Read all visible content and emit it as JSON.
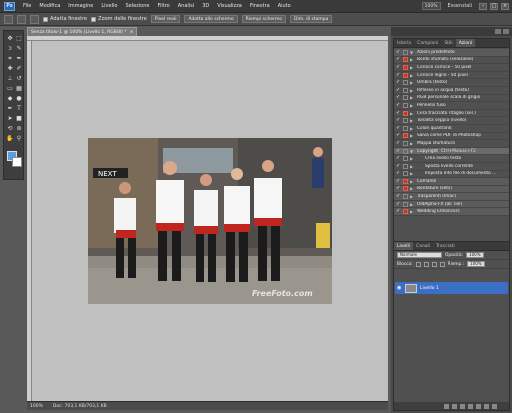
{
  "app": {
    "logo": "Ps"
  },
  "menu": [
    "File",
    "Modifica",
    "Immagine",
    "Livello",
    "Selezione",
    "Filtro",
    "Analisi",
    "3D",
    "Visualizza",
    "Finestra",
    "Aiuto"
  ],
  "menu_right": {
    "zoom": "100%",
    "workspace": "Essenziali"
  },
  "options": {
    "check1": "Adatta finestre",
    "check2": "Zoom delle finestre",
    "btn1": "Pixel reali",
    "btn2": "Adatta allo schermo",
    "btn3": "Riempi schermo",
    "btn4": "Dim. di stampa"
  },
  "doc_tab": {
    "title": "Senza titolo-1 @ 100% (Livello 1, RGB/8) *",
    "close": "×"
  },
  "photo": {
    "sign": "NEXT",
    "watermark": "FreeFoto.com"
  },
  "status": {
    "zoom": "100%",
    "doc": "Doc: 703,1 KB/703,1 KB"
  },
  "actions_panel": {
    "tabs": [
      "Istoria",
      "Campioni",
      "Stili",
      "Azioni"
    ],
    "active_tab": "Azioni",
    "rows": [
      {
        "label": "Azioni predefinite",
        "type": "set",
        "dialog": false,
        "tri": "▼"
      },
      {
        "label": "Bordo sfumato (selezione)",
        "type": "action",
        "dialog": true,
        "tri": "▶"
      },
      {
        "label": "Cornice cornice - 50 pixel",
        "type": "action",
        "dialog": true,
        "tri": "▶"
      },
      {
        "label": "Cornice legno - 50 pixel",
        "type": "action",
        "dialog": true,
        "tri": "▶"
      },
      {
        "label": "Ombra (testo)",
        "type": "action",
        "dialog": false,
        "tri": "▶"
      },
      {
        "label": "Riflesso in acqua (testo)",
        "type": "action",
        "dialog": false,
        "tri": "▶"
      },
      {
        "label": "RGB personale scala di grigio",
        "type": "action",
        "dialog": false,
        "tri": "▶"
      },
      {
        "label": "Pennello fuso",
        "type": "action",
        "dialog": false,
        "tri": "▶"
      },
      {
        "label": "Cera tracciato ritaglio (sel.)",
        "type": "action",
        "dialog": true,
        "tri": "▶"
      },
      {
        "label": "Tonalità seppia (livello)",
        "type": "action",
        "dialog": false,
        "tri": "▶"
      },
      {
        "label": "Colori quadranti",
        "type": "action",
        "dialog": false,
        "tri": "▶"
      },
      {
        "label": "Salva come PDF di Photoshop",
        "type": "action",
        "dialog": true,
        "tri": "▶"
      },
      {
        "label": "Mappa sfumatura",
        "type": "action",
        "dialog": false,
        "tri": "▶"
      },
      {
        "label": "Copyright",
        "type": "selected",
        "dialog": false,
        "tri": "▼",
        "extra": "Ctrl+Maiusc+F2"
      },
      {
        "label": "Crea livello testo",
        "type": "step",
        "dialog": false,
        "tri": "▶"
      },
      {
        "label": "Sposta livello corrente",
        "type": "step",
        "dialog": false,
        "tri": "▶"
      },
      {
        "label": "Imposta Info file di documento ...",
        "type": "step",
        "dialog": false,
        "tri": "▶"
      },
      {
        "label": "Comandi",
        "type": "set",
        "dialog": true,
        "tri": "▶"
      },
      {
        "label": "Bordature (sets)",
        "type": "set",
        "dialog": true,
        "tri": "▶"
      },
      {
        "label": "Trasparenti (Imac)",
        "type": "set",
        "dialog": false,
        "tri": "▶"
      },
      {
        "label": "OldAlpha-FX (all Tiel)",
        "type": "set",
        "dialog": false,
        "tri": "▶"
      },
      {
        "label": "Wedding Enhancers",
        "type": "set",
        "dialog": true,
        "tri": "▶"
      }
    ]
  },
  "layers_panel": {
    "tabs": [
      "Livelli",
      "Canali",
      "Tracciati"
    ],
    "active_tab": "Livelli",
    "blend_mode": "Normale",
    "opacity_label": "Opacità:",
    "opacity": "100%",
    "lock_label": "Blocca:",
    "fill_label": "Riemp.:",
    "fill": "100%",
    "layer_name": "Livello 1"
  }
}
